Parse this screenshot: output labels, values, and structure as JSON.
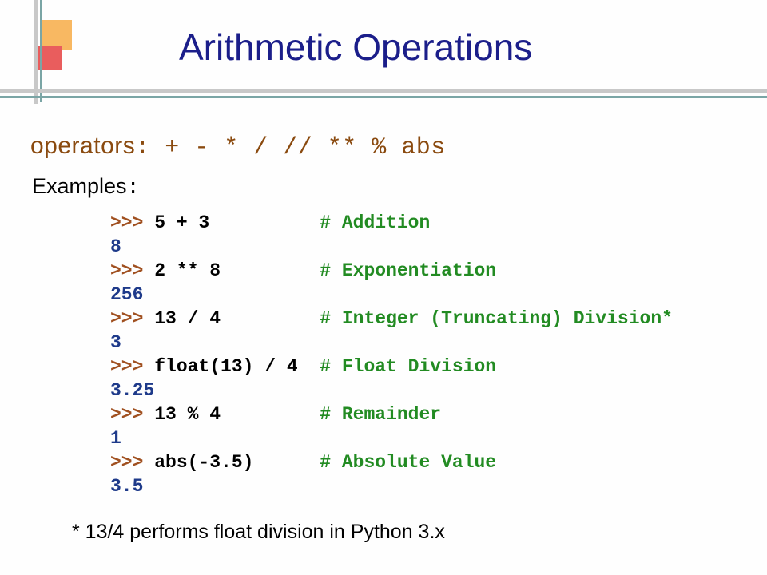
{
  "title": "Arithmetic Operations",
  "operators": {
    "label": "operators",
    "symbols": ": +  -  *  /  //  **  %  abs"
  },
  "examples_label": "Examples",
  "examples_colon": ":",
  "code": {
    "lines": [
      {
        "prompt": ">>> ",
        "expr": "5 + 3          ",
        "comment": "# Addition"
      },
      {
        "result": "8"
      },
      {
        "prompt": ">>> ",
        "expr": "2 ** 8         ",
        "comment": "# Exponentiation"
      },
      {
        "result": "256"
      },
      {
        "prompt": ">>> ",
        "expr": "13 / 4         ",
        "comment": "# Integer (Truncating) Division*"
      },
      {
        "result": "3"
      },
      {
        "prompt": ">>> ",
        "expr": "float(13) / 4  ",
        "comment": "# Float Division"
      },
      {
        "result": "3.25"
      },
      {
        "prompt": ">>> ",
        "expr": "13 % 4         ",
        "comment": "# Remainder"
      },
      {
        "result": "1"
      },
      {
        "prompt": ">>> ",
        "expr": "abs(-3.5)      ",
        "comment": "# Absolute Value"
      },
      {
        "result": "3.5"
      }
    ]
  },
  "footnote": "* 13/4 performs float division in Python 3.x"
}
